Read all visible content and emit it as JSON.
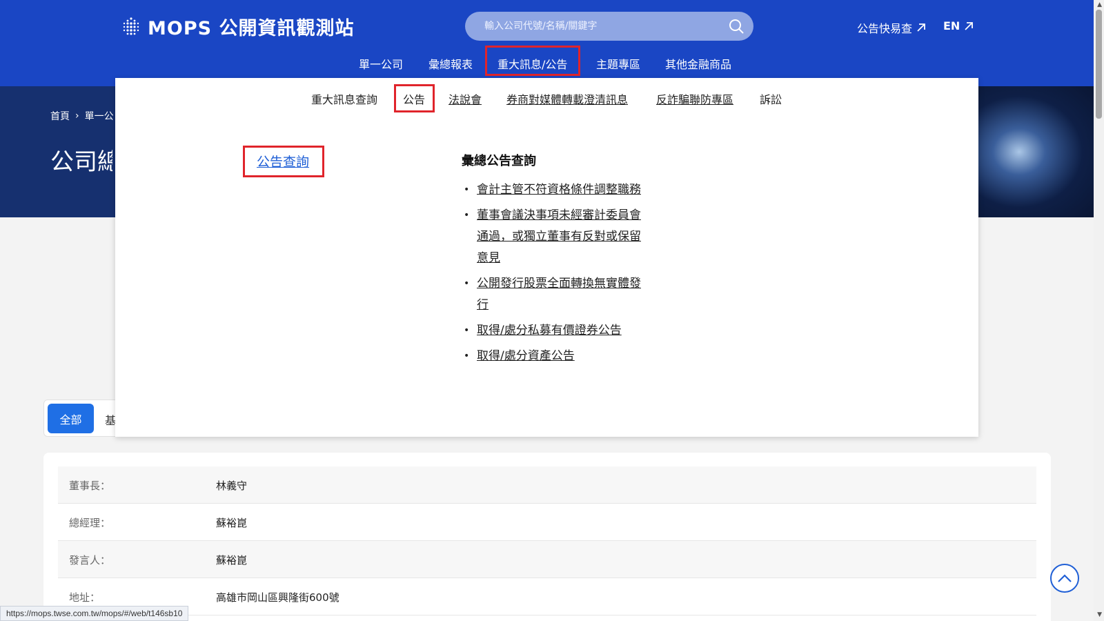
{
  "header": {
    "logo_text": "MOPS 公開資訊觀測站",
    "search_placeholder": "輸入公司代號/名稱/關鍵字",
    "quick_link": "公告快易查",
    "lang_link": "EN",
    "brand_color": "#1a46c4"
  },
  "main_nav": {
    "items": [
      {
        "label": "單一公司"
      },
      {
        "label": "彙總報表"
      },
      {
        "label": "重大訊息/公告",
        "active": true
      },
      {
        "label": "主題專區"
      },
      {
        "label": "其他金融商品"
      }
    ]
  },
  "banner": {
    "breadcrumb": [
      "首頁",
      "單一公"
    ],
    "title": "公司總"
  },
  "dropdown": {
    "subnav": [
      {
        "label": "重大訊息查詢"
      },
      {
        "label": "公告",
        "active": true
      },
      {
        "label": "法說會"
      },
      {
        "label": "券商對媒體轉載澄清訊息"
      },
      {
        "label": "反詐騙聯防專區"
      },
      {
        "label": "訴訟"
      }
    ],
    "query_link": "公告查詢",
    "section_title": "彙總公告查詢",
    "links": [
      {
        "label": "會計主管不符資格條件調整職務"
      },
      {
        "label": "董事會議決事項未經審計委員會通過，或獨立董事有反對或保留意見"
      },
      {
        "label": "公開發行股票全面轉換無實體發行"
      },
      {
        "label": "取得/處分私募有價證券公告"
      },
      {
        "label": "取得/處分資產公告"
      }
    ]
  },
  "filters": {
    "all_label": "全部",
    "basic_label": "基"
  },
  "info_rows": [
    {
      "key": "董事長：",
      "value": "林義守"
    },
    {
      "key": "總經理：",
      "value": "蘇裕崑"
    },
    {
      "key": "發言人：",
      "value": "蘇裕崑"
    },
    {
      "key": "地址：",
      "value": "高雄市岡山區興隆街600號"
    }
  ],
  "status_url": "https://mops.twse.com.tw/mops/#/web/t146sb10"
}
